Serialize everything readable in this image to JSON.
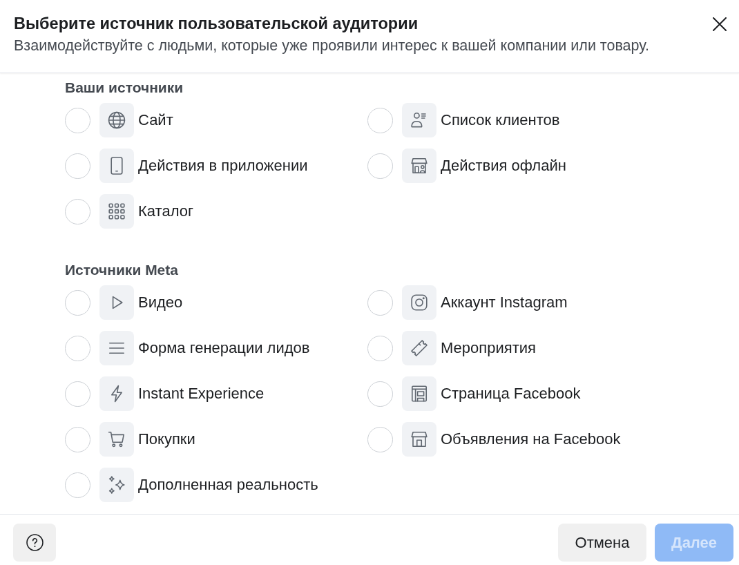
{
  "dialog": {
    "title": "Выберите источник пользовательской аудитории",
    "subtitle": "Взаимодействуйте с людьми, которые уже проявили интерес к вашей компании или товару."
  },
  "sections": [
    {
      "heading": "Ваши источники",
      "options": [
        {
          "label": "Сайт",
          "selected": false
        },
        {
          "label": "Список клиентов",
          "selected": false
        },
        {
          "label": "Действия в приложении",
          "selected": false
        },
        {
          "label": "Действия офлайн",
          "selected": false
        },
        {
          "label": "Каталог",
          "selected": false
        }
      ]
    },
    {
      "heading": "Источники Meta",
      "options": [
        {
          "label": "Видео",
          "selected": false
        },
        {
          "label": "Аккаунт Instagram",
          "selected": false
        },
        {
          "label": "Форма генерации лидов",
          "selected": false
        },
        {
          "label": "Мероприятия",
          "selected": false
        },
        {
          "label": "Instant Experience",
          "selected": false
        },
        {
          "label": "Страница Facebook",
          "selected": false
        },
        {
          "label": "Покупки",
          "selected": false
        },
        {
          "label": "Объявления на Facebook",
          "selected": false
        },
        {
          "label": "Дополненная реальность",
          "selected": false
        }
      ]
    }
  ],
  "footer": {
    "cancel": {
      "label": "Отмена"
    },
    "next": {
      "label": "Далее",
      "disabled": true
    }
  }
}
